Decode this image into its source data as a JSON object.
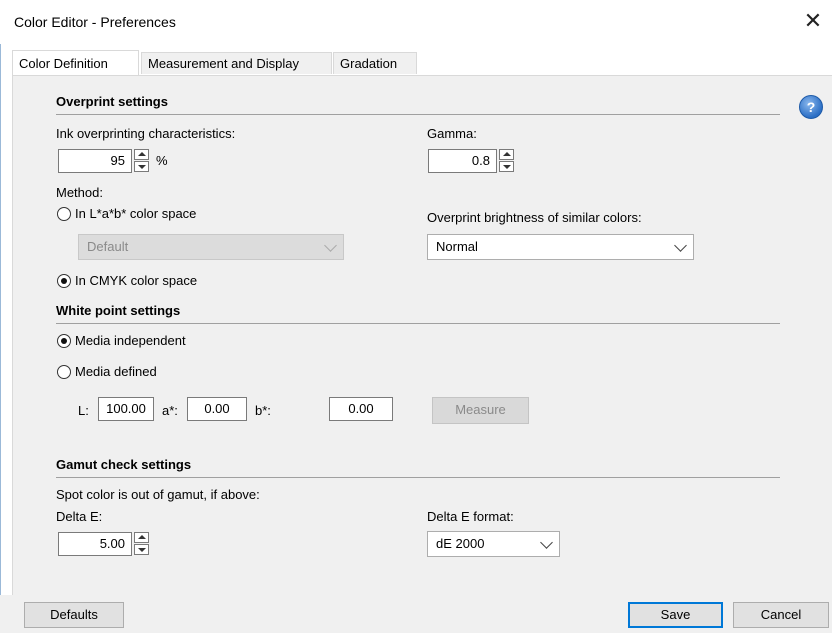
{
  "window": {
    "title": "Color Editor - Preferences",
    "close_glyph": "✕"
  },
  "tabs": [
    {
      "label": "Color Definition",
      "active": true
    },
    {
      "label": "Measurement and Display",
      "active": false
    },
    {
      "label": "Gradation",
      "active": false
    }
  ],
  "help_icon": "question-icon",
  "overprint": {
    "title": "Overprint settings",
    "ink_label": "Ink overprinting characteristics:",
    "ink_value": "95",
    "ink_unit": "%",
    "gamma_label": "Gamma:",
    "gamma_value": "0.8",
    "method_label": "Method:",
    "method_lab_label": "In L*a*b* color space",
    "lab_combo_value": "Default",
    "method_cmyk_label": "In CMYK color space",
    "brightness_label": "Overprint brightness of similar colors:",
    "brightness_value": "Normal",
    "selected_method": "cmyk"
  },
  "whitepoint": {
    "title": "White point settings",
    "media_independent_label": "Media independent",
    "media_defined_label": "Media defined",
    "selected": "media_independent",
    "l_label": "L:",
    "l_value": "100.00",
    "a_label": "a*:",
    "a_value": "0.00",
    "b_label": "b*:",
    "b_value": "0.00",
    "measure_label": "Measure"
  },
  "gamut": {
    "title": "Gamut check settings",
    "description": "Spot color is out of gamut, if above:",
    "delta_label": "Delta E:",
    "delta_value": "5.00",
    "format_label": "Delta E format:",
    "format_value": "dE 2000"
  },
  "footer": {
    "defaults_label": "Defaults",
    "save_label": "Save",
    "cancel_label": "Cancel"
  }
}
